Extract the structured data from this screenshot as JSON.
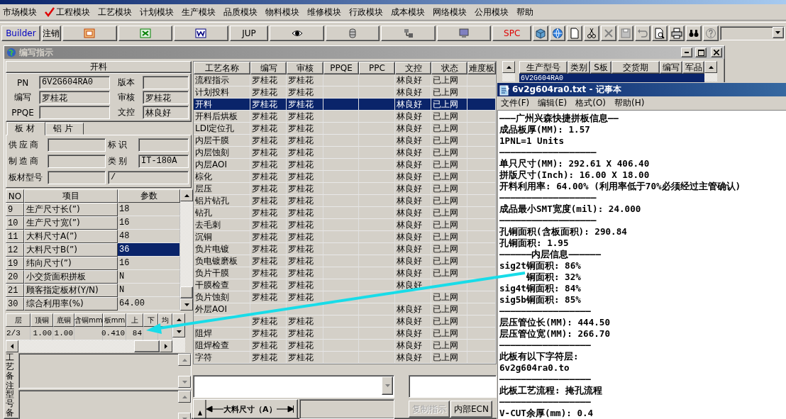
{
  "menu": [
    {
      "label": "市场模块",
      "checked": false
    },
    {
      "label": "工程模块",
      "checked": true
    },
    {
      "label": "工艺模块",
      "checked": false
    },
    {
      "label": "计划模块",
      "checked": false
    },
    {
      "label": "生产模块",
      "checked": false
    },
    {
      "label": "品质模块",
      "checked": false
    },
    {
      "label": "物料模块",
      "checked": false
    },
    {
      "label": "维修模块",
      "checked": false
    },
    {
      "label": "行政模块",
      "checked": false
    },
    {
      "label": "成本模块",
      "checked": false
    },
    {
      "label": "网络模块",
      "checked": false
    },
    {
      "label": "公用模块",
      "checked": false
    },
    {
      "label": "帮助",
      "checked": false
    }
  ],
  "toolbar": [
    {
      "kind": "text",
      "label": "Builder",
      "color": "#0000c0"
    },
    {
      "kind": "text",
      "label": "注销",
      "color": "#000000"
    },
    {
      "kind": "icon"
    },
    {
      "kind": "icon"
    },
    {
      "kind": "icon"
    },
    {
      "kind": "text",
      "label": "JUP",
      "color": "#000000"
    },
    {
      "kind": "icon"
    },
    {
      "kind": "icon"
    },
    {
      "kind": "icon"
    },
    {
      "kind": "icon"
    },
    {
      "kind": "text",
      "label": "SPC",
      "color": "#e00000"
    },
    {
      "kind": "tool"
    },
    {
      "kind": "tool"
    },
    {
      "kind": "tool"
    },
    {
      "kind": "tool"
    },
    {
      "kind": "tool"
    },
    {
      "kind": "tool"
    },
    {
      "kind": "tool"
    },
    {
      "kind": "tool"
    },
    {
      "kind": "tool"
    },
    {
      "kind": "tool"
    },
    {
      "kind": "tool"
    },
    {
      "kind": "combo"
    }
  ],
  "window": {
    "title": "编写指示"
  },
  "left_panel": {
    "header": "开料",
    "info_fields": [
      {
        "label": "PN",
        "value": "6V2G604RA0"
      },
      {
        "label": "版本"
      },
      {
        "label": "编写",
        "value": "罗桂花"
      },
      {
        "label": "审核",
        "value": "罗桂花"
      },
      {
        "label": "PPQE"
      },
      {
        "label": "文控",
        "value": "林良好"
      }
    ],
    "tabs": [
      {
        "label": "板材",
        "selected": true
      },
      {
        "label": "铝片",
        "selected": false
      }
    ],
    "material_fields": [
      {
        "label": "供应商"
      },
      {
        "label": "标识"
      },
      {
        "label": "制造商"
      },
      {
        "label": "类别",
        "value": "IT-180A"
      },
      {
        "label": "板材型号",
        "extra": "/"
      }
    ],
    "param_table": {
      "columns": [
        "NO",
        "项目",
        "参数"
      ],
      "rows": [
        {
          "no": "9",
          "item": "生产尺寸长(”)",
          "value": "18",
          "selected": false
        },
        {
          "no": "10",
          "item": "生产尺寸宽(”)",
          "value": "16",
          "selected": false
        },
        {
          "no": "11",
          "item": "大料尺寸A(”)",
          "value": "48",
          "selected": false
        },
        {
          "no": "12",
          "item": "大料尺寸B(”)",
          "value": "36",
          "selected": true
        },
        {
          "no": "19",
          "item": "纬向尺寸(”)",
          "value": "16",
          "selected": false
        },
        {
          "no": "20",
          "item": "小交货面积拼板",
          "value": "N",
          "selected": false
        },
        {
          "no": "21",
          "item": "顾客指定板材(Y/N)",
          "value": "N",
          "selected": false
        },
        {
          "no": "30",
          "item": "综合利用率(%)",
          "value": "64.00",
          "selected": false
        }
      ]
    },
    "layer_table": {
      "columns": [
        "层",
        "顶铜",
        "底铜",
        "含铜mm",
        "板mm",
        "上",
        "下",
        "均"
      ],
      "rows": [
        {
          "layer": "2/3",
          "top_cu": "1.00",
          "bottom_cu": "1.00",
          "board_mm": "0.410",
          "upper": "84"
        }
      ]
    },
    "remarks": [
      {
        "label": "工艺备注"
      },
      {
        "label": "型号备"
      }
    ]
  },
  "process_table": {
    "columns": [
      "工艺名称",
      "编写",
      "审核",
      "PPQE",
      "PPC",
      "文控",
      "状态",
      "难度板"
    ],
    "rows": [
      {
        "name": "流程指示",
        "writer": "罗桂花",
        "reviewer": "罗桂花",
        "doc_control": "林良好",
        "status": "已上网",
        "selected": false
      },
      {
        "name": "计划投料",
        "writer": "罗桂花",
        "reviewer": "罗桂花",
        "doc_control": "林良好",
        "status": "已上网",
        "selected": false
      },
      {
        "name": "开料",
        "writer": "罗桂花",
        "reviewer": "罗桂花",
        "doc_control": "林良好",
        "status": "已上网",
        "selected": true
      },
      {
        "name": "开料后烘板",
        "writer": "罗桂花",
        "reviewer": "罗桂花",
        "doc_control": "林良好",
        "status": "已上网",
        "selected": false
      },
      {
        "name": "LDI定位孔",
        "writer": "罗桂花",
        "reviewer": "罗桂花",
        "doc_control": "林良好",
        "status": "已上网",
        "selected": false
      },
      {
        "name": "内层干膜",
        "writer": "罗桂花",
        "reviewer": "罗桂花",
        "doc_control": "林良好",
        "status": "已上网",
        "selected": false
      },
      {
        "name": "内层蚀刻",
        "writer": "罗桂花",
        "reviewer": "罗桂花",
        "doc_control": "林良好",
        "status": "已上网",
        "selected": false
      },
      {
        "name": "内层AOI",
        "writer": "罗桂花",
        "reviewer": "罗桂花",
        "doc_control": "林良好",
        "status": "已上网",
        "selected": false
      },
      {
        "name": "棕化",
        "writer": "罗桂花",
        "reviewer": "罗桂花",
        "doc_control": "林良好",
        "status": "已上网",
        "selected": false
      },
      {
        "name": "层压",
        "writer": "罗桂花",
        "reviewer": "罗桂花",
        "doc_control": "林良好",
        "status": "已上网",
        "selected": false
      },
      {
        "name": "铝片钻孔",
        "writer": "罗桂花",
        "reviewer": "罗桂花",
        "doc_control": "林良好",
        "status": "已上网",
        "selected": false
      },
      {
        "name": "钻孔",
        "writer": "罗桂花",
        "reviewer": "罗桂花",
        "doc_control": "林良好",
        "status": "已上网",
        "selected": false
      },
      {
        "name": "去毛刺",
        "writer": "罗桂花",
        "reviewer": "罗桂花",
        "doc_control": "林良好",
        "status": "已上网",
        "selected": false
      },
      {
        "name": "沉铜",
        "writer": "罗桂花",
        "reviewer": "罗桂花",
        "doc_control": "林良好",
        "status": "已上网",
        "selected": false
      },
      {
        "name": "负片电镀",
        "writer": "罗桂花",
        "reviewer": "罗桂花",
        "doc_control": "林良好",
        "status": "已上网",
        "selected": false
      },
      {
        "name": "负电镀磨板",
        "writer": "罗桂花",
        "reviewer": "罗桂花",
        "doc_control": "林良好",
        "status": "已上网",
        "selected": false
      },
      {
        "name": "负片干膜",
        "writer": "罗桂花",
        "reviewer": "罗桂花",
        "doc_control": "林良好",
        "status": "已上网",
        "selected": false
      },
      {
        "name": "干膜检查",
        "writer": "罗桂花",
        "reviewer": "罗桂花",
        "doc_control": "林良好",
        "selected": false
      },
      {
        "name": "负片蚀刻",
        "writer": "罗桂花",
        "reviewer": "罗桂花",
        "status": "已上网",
        "selected": false
      },
      {
        "name": "外层AOI",
        "doc_control": "林良好",
        "status": "已上网",
        "selected": false
      },
      {
        "writer": "罗桂花",
        "reviewer": "罗桂花",
        "doc_control": "林良好",
        "status": "已上网",
        "selected": false
      },
      {
        "name": "阻焊",
        "writer": "罗桂花",
        "reviewer": "罗桂花",
        "doc_control": "林良好",
        "status": "已上网",
        "selected": false
      },
      {
        "name": "阻焊检查",
        "writer": "罗桂花",
        "reviewer": "罗桂花",
        "doc_control": "林良好",
        "status": "已上网",
        "selected": false
      },
      {
        "name": "字符",
        "writer": "罗桂花",
        "reviewer": "罗桂花",
        "doc_control": "林良好",
        "status": "已上网",
        "selected": false
      }
    ]
  },
  "bottom": {
    "dimension_label": "大料尺寸（A）",
    "buttons": [
      {
        "label": "复制指示",
        "disabled": true
      },
      {
        "label": "内部ECN",
        "disabled": false
      }
    ]
  },
  "model_table": {
    "columns": [
      "生产型号",
      "类别",
      "S板",
      "交货期",
      "编写",
      "军品"
    ],
    "rows": [
      {
        "model": "6V2G604RA0",
        "selected": true
      }
    ]
  },
  "notepad": {
    "title": "6v2g604ra0.txt - 记事本",
    "menu": [
      {
        "label": "文件(F)"
      },
      {
        "label": "编辑(E)"
      },
      {
        "label": "格式(O)"
      },
      {
        "label": "帮助(H)"
      }
    ],
    "lines": [
      "———广州兴森快捷拼板信息——",
      "成品板厚(MM): 1.57",
      "1PNL=1 Units",
      "——————————————————",
      "单只尺寸(MM): 292.61 X 406.40",
      "拼版尺寸(Inch): 16.00 X 18.00",
      "开料利用率: 64.00% (利用率低于70%必须经过主管确认)",
      "——————————————————",
      "成品最小SMT宽度(mil): 24.000",
      "——————————————————",
      "孔铜面积(含板面积): 290.84",
      "孔铜面积: 1.95",
      "——————内层信息——————",
      "sig2t铜面积: 86%",
      "     铜面积: 32%",
      "sig4t铜面积: 84%",
      "sig5b铜面积: 85%",
      "—————————————————",
      "层压管位长(MM): 444.50",
      "层压管位宽(MM): 266.70",
      "—————————————————",
      "此板有以下字符层:",
      "6v2g604ra0.to",
      "—————————————————",
      "此板工艺流程: 掩孔流程",
      "—————————————————",
      "V-CUT余厚(mm): 0.4"
    ]
  }
}
